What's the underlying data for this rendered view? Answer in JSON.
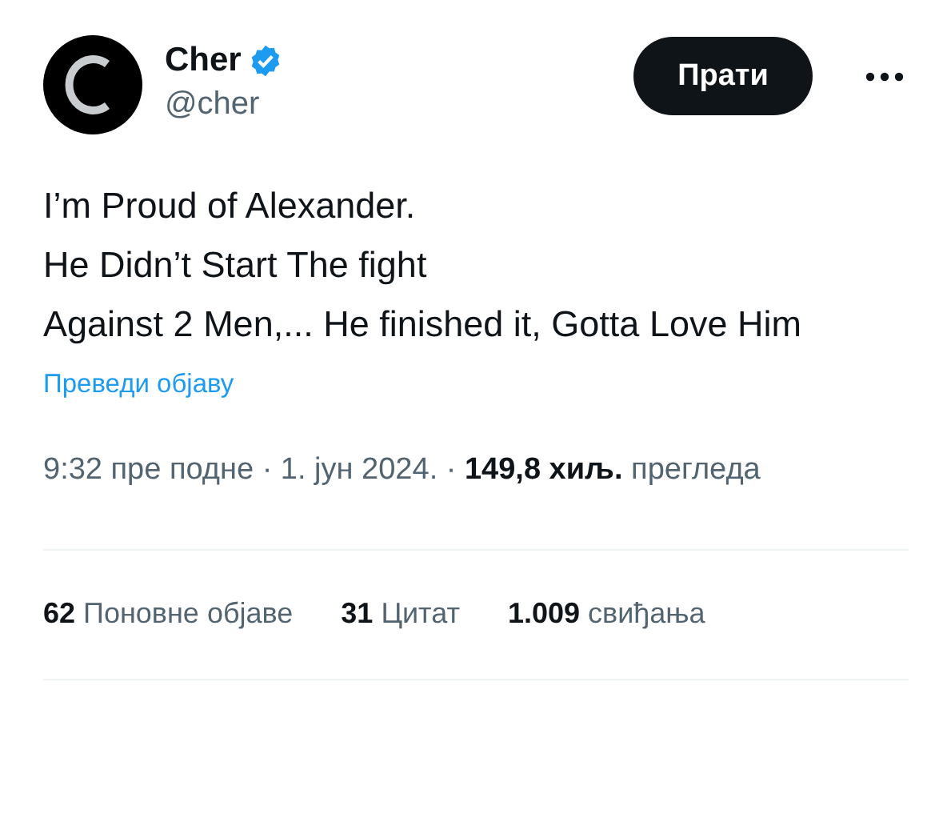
{
  "author": {
    "name": "Cher",
    "verified": true,
    "handle": "@cher"
  },
  "follow_button": {
    "label": "Прати"
  },
  "post": {
    "lines": [
      "I’m Proud of Alexander.",
      "He Didn’t Start The fight",
      "Against 2 Men,... He finished it, Gotta Love Him"
    ],
    "translate_link": "Преведи објаву"
  },
  "meta": "9:32 пре подне · 1. јун 2024. · **149,8 хиљ.** прегледа",
  "stats": [
    {
      "count": "62",
      "label": "Поновне објаве"
    },
    {
      "count": "31",
      "label": "Цитат"
    },
    {
      "count": "1.009",
      "label": "свиђања"
    }
  ]
}
